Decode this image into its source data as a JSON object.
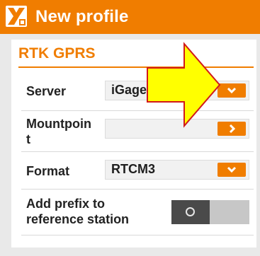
{
  "header": {
    "title": "New profile",
    "logo_icon": "app-logo-icon",
    "accent_color": "#f07d00"
  },
  "section": {
    "title": "RTK GPRS"
  },
  "fields": {
    "server": {
      "label": "Server",
      "value": "iGageI",
      "control_icon": "chevron-down-icon"
    },
    "mountpoint": {
      "label": "Mountpoin t",
      "value": "",
      "control_icon": "chevron-right-icon"
    },
    "format": {
      "label": "Format",
      "value": "RTCM3",
      "control_icon": "chevron-down-icon"
    },
    "prefix": {
      "label": "Add prefix to reference station",
      "state": "off"
    }
  },
  "annotation": {
    "icon": "callout-arrow-icon",
    "color": "#ffff00"
  }
}
